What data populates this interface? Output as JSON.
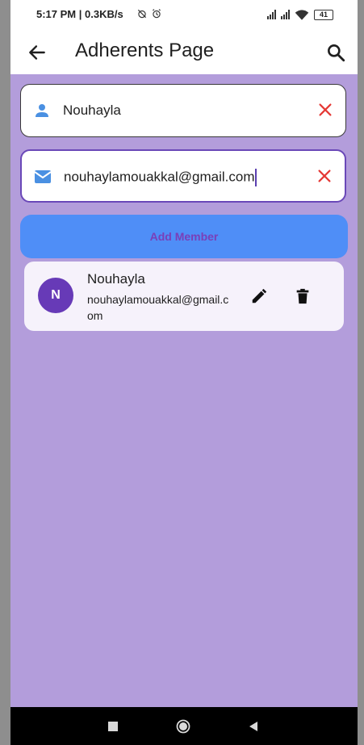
{
  "status_bar": {
    "time": "5:17 PM | 0.3KB/s",
    "battery": "41",
    "icons": [
      "alarm-off-icon",
      "alarm-icon",
      "signal-icon",
      "signal-icon",
      "wifi-icon",
      "battery-icon"
    ]
  },
  "app_bar": {
    "title": "Adherents Page",
    "back_icon": "arrow-left-icon",
    "search_icon": "search-icon"
  },
  "form": {
    "name_value": "Nouhayla",
    "email_value": "nouhaylamouakkal@gmail.com",
    "add_button_label": "Add Member"
  },
  "members": [
    {
      "initial": "N",
      "name": "Nouhayla",
      "email": "nouhaylamouakkal@gmail.com"
    }
  ],
  "colors": {
    "background": "#b39ddb",
    "button": "#4f8ef7",
    "button_text": "#7a3fb8",
    "avatar": "#673ab7",
    "clear_icon": "#e53935",
    "field_icon": "#4a90e2",
    "navbar": "#000000"
  }
}
